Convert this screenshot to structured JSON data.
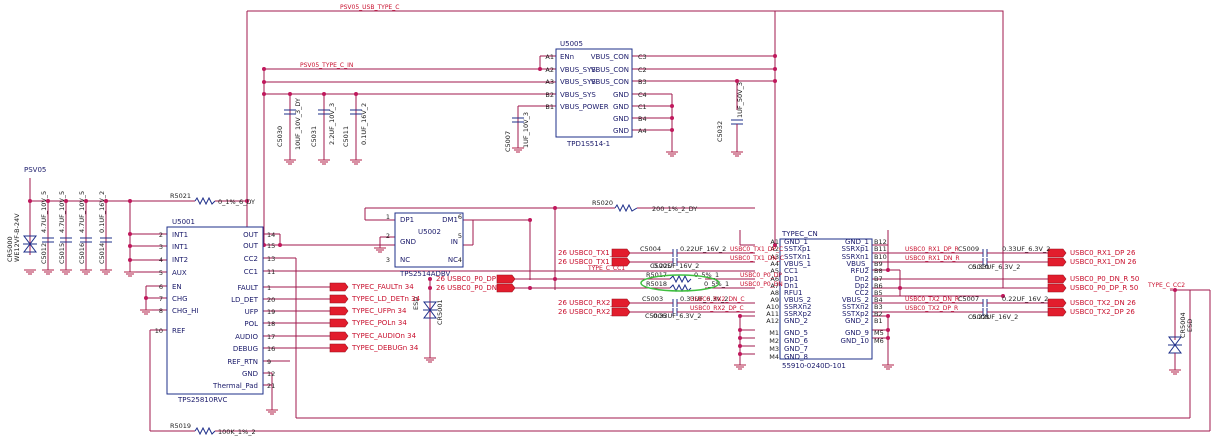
{
  "nets": {
    "psvbus_top": "PSV05_USB_TYPE_C",
    "psvbus_in": "PSV05_TYPE_C_IN",
    "psv05": "PSV05",
    "type_c_cc1": "TYPE_C_CC1",
    "type_c_cc2": "TYPE_C_CC2"
  },
  "u5005": {
    "ref": "U5005",
    "part": "TPD1S514-1",
    "left_pins": [
      {
        "num": "A1",
        "name": "ENn"
      },
      {
        "num": "A2",
        "name": "VBUS_SYS"
      },
      {
        "num": "A3",
        "name": "VBUS_SYS"
      },
      {
        "num": "B2",
        "name": "VBUS_SYS"
      },
      {
        "num": "B1",
        "name": "VBUS_POWER"
      }
    ],
    "right_pins": [
      {
        "num": "C3",
        "name": "VBUS_CON"
      },
      {
        "num": "C2",
        "name": "VBUS_CON"
      },
      {
        "num": "B3",
        "name": "VBUS_CON"
      },
      {
        "num": "C4",
        "name": "GND"
      },
      {
        "num": "C1",
        "name": "GND"
      },
      {
        "num": "B4",
        "name": "GND"
      },
      {
        "num": "A4",
        "name": "GND"
      }
    ]
  },
  "u5001": {
    "ref": "U5001",
    "part": "TPS25810RVC",
    "left_pins": [
      {
        "num": "2",
        "name": "INT1"
      },
      {
        "num": "3",
        "name": "INT1"
      },
      {
        "num": "4",
        "name": "INT2"
      },
      {
        "num": "5",
        "name": "AUX"
      },
      {
        "num": "6",
        "name": "EN"
      },
      {
        "num": "7",
        "name": "CHG"
      },
      {
        "num": "8",
        "name": "CHG_HI"
      },
      {
        "num": "10",
        "name": "REF"
      }
    ],
    "right_pins": [
      {
        "num": "14",
        "name": "OUT"
      },
      {
        "num": "15",
        "name": "OUT"
      },
      {
        "num": "13",
        "name": "CC2"
      },
      {
        "num": "11",
        "name": "CC1"
      },
      {
        "num": "1",
        "name": "FAULT"
      },
      {
        "num": "20",
        "name": "LD_DET"
      },
      {
        "num": "19",
        "name": "UFP"
      },
      {
        "num": "18",
        "name": "POL"
      },
      {
        "num": "17",
        "name": "AUDIO"
      },
      {
        "num": "16",
        "name": "DEBUG"
      },
      {
        "num": "9",
        "name": "REF_RTN"
      },
      {
        "num": "12",
        "name": "GND"
      },
      {
        "num": "21",
        "name": "Thermal_Pad"
      }
    ]
  },
  "u5002": {
    "ref": "U5002",
    "part": "TPS2514ADBV",
    "pins": [
      {
        "num": "1",
        "name": "DP1"
      },
      {
        "num": "6",
        "name": "DM1"
      },
      {
        "num": "2",
        "name": "GND"
      },
      {
        "num": "5",
        "name": "IN"
      },
      {
        "num": "3",
        "name": "NC"
      },
      {
        "num": "4",
        "name": "NC"
      }
    ]
  },
  "connector": {
    "ref": "TYPEC_CN",
    "part": "55910-0240D-101",
    "left_pins": [
      {
        "num": "A1",
        "name": "GND_1"
      },
      {
        "num": "A2",
        "name": "SSTXp1"
      },
      {
        "num": "A3",
        "name": "SSTXn1"
      },
      {
        "num": "A4",
        "name": "VBUS_1"
      },
      {
        "num": "A5",
        "name": "CC1"
      },
      {
        "num": "A6",
        "name": "Dp1"
      },
      {
        "num": "A7",
        "name": "Dn1"
      },
      {
        "num": "A8",
        "name": "RFU1"
      },
      {
        "num": "A9",
        "name": "VBUS_2"
      },
      {
        "num": "A10",
        "name": "SSRXn2"
      },
      {
        "num": "A11",
        "name": "SSRXp2"
      },
      {
        "num": "A12",
        "name": "GND_2"
      },
      {
        "num": "M1",
        "name": "GND_5"
      },
      {
        "num": "M2",
        "name": "GND_6"
      },
      {
        "num": "M3",
        "name": "GND_7"
      },
      {
        "num": "M4",
        "name": "GND_8"
      }
    ],
    "right_pins": [
      {
        "num": "B12",
        "name": "GND_1"
      },
      {
        "num": "B11",
        "name": "SSRXp1"
      },
      {
        "num": "B10",
        "name": "SSRXn1"
      },
      {
        "num": "B9",
        "name": "VBUS_"
      },
      {
        "num": "B8",
        "name": "RFU2"
      },
      {
        "num": "B7",
        "name": "Dn2"
      },
      {
        "num": "B6",
        "name": "Dp2"
      },
      {
        "num": "B5",
        "name": "CC2"
      },
      {
        "num": "B4",
        "name": "VBUS_2"
      },
      {
        "num": "B3",
        "name": "SSTXn2"
      },
      {
        "num": "B2",
        "name": "SSTXp2"
      },
      {
        "num": "B1",
        "name": "GND_2"
      },
      {
        "num": "M5",
        "name": "GND_9"
      },
      {
        "num": "M6",
        "name": "GND_10"
      }
    ]
  },
  "caps_top": [
    {
      "ref": "C5030",
      "val": "10UF_10V_3_DY"
    },
    {
      "ref": "C5031",
      "val": "2.2UF_10V_3"
    },
    {
      "ref": "C5011",
      "val": "0.1UF_16V_2"
    },
    {
      "ref": "C5007",
      "val": "1UF_10V_3"
    },
    {
      "ref": "C5032",
      "val": "1UF_50V_3"
    }
  ],
  "caps_left": [
    {
      "ref": "C5012",
      "val": "4.7UF_10V_5"
    },
    {
      "ref": "C5015",
      "val": "4.7UF_10V_5"
    },
    {
      "ref": "C5016",
      "val": "4.7UF_10V_5"
    },
    {
      "ref": "C5014",
      "val": "0.1UF_16V_2"
    }
  ],
  "esd_left": {
    "ref": "CR5000",
    "val": "WE12VF-B-24V"
  },
  "esd_mid": {
    "ref": "CR5001",
    "val": "ESD"
  },
  "esd_right": {
    "ref": "CR5004",
    "val": "ESD"
  },
  "resistors": {
    "r5021": {
      "ref": "R5021",
      "val": "0_1%_6_DY"
    },
    "r5019": {
      "ref": "R5019",
      "val": "100K_1%_2"
    },
    "r5020": {
      "ref": "R5020",
      "val": "200_1%_2_DY"
    },
    "r5017": {
      "ref": "R5017",
      "val": "0_5%_1"
    },
    "r5018": {
      "ref": "R5018",
      "val": "0_5%_1"
    }
  },
  "status_tags": [
    {
      "num": "1",
      "name": "TYPEC_FAULTn",
      "page": "34"
    },
    {
      "num": "20",
      "name": "TYPEC_LD_DETn",
      "page": "34"
    },
    {
      "num": "19",
      "name": "TYPEC_UFPn",
      "page": "34"
    },
    {
      "num": "18",
      "name": "TYPEC_POLn",
      "page": "34"
    },
    {
      "num": "17",
      "name": "TYPEC_AUDIOn",
      "page": "34"
    },
    {
      "num": "16",
      "name": "TYPEC_DEBUGn",
      "page": "34"
    }
  ],
  "usb2_tags": [
    {
      "page": "26",
      "name": "USBC0_P0_DP"
    },
    {
      "page": "26",
      "name": "USBC0_P0_DN"
    }
  ],
  "left_ss_tags": [
    {
      "page": "26",
      "name": "USBC0_TX1_DP",
      "cap": "C5004",
      "cap_val": "0.22UF_16V_2"
    },
    {
      "page": "26",
      "name": "USBC0_TX1_DN",
      "cap": "C5005",
      "cap_val": "0.22UF_16V_2"
    },
    {
      "page": "26",
      "name": "USBC0_RX2_DN",
      "cap": "C5003",
      "cap_val": "0.33UF_6.3V_2"
    },
    {
      "page": "26",
      "name": "USBC0_RX2_DP",
      "cap": "C5006",
      "cap_val": "0.33UF_6.3V_2"
    }
  ],
  "right_ss_tags": [
    {
      "name": "USBC0_RX1_DP",
      "page": "26",
      "cap": "C5009",
      "cap_val": "0.33UF_6.3V_2"
    },
    {
      "name": "USBC0_RX1_DN",
      "page": "26",
      "cap": "C5010",
      "cap_val": "0.33UF_6.3V_2"
    },
    {
      "name": "USBC0_P0_DN_R",
      "page": "50"
    },
    {
      "name": "USBC0_P0_DP_R",
      "page": "50"
    },
    {
      "name": "USBC0_TX2_DN",
      "page": "26",
      "cap": "C5007",
      "cap_val": "0.22UF_16V_2"
    },
    {
      "name": "USBC0_TX2_DP",
      "page": "26",
      "cap": "C5008",
      "cap_val": "0.22UF_16V_2"
    }
  ],
  "trace_labels": [
    "USBC0_TX1_DP_C",
    "USBC0_TX1_DN_C",
    "USBC0_P0_DP",
    "USBC0_P0_DN",
    "USBC0_RX2_DN_C",
    "USBC0_RX2_DP_C",
    "USBC0_RX1_DP_R",
    "USBC0_RX1_DN_R",
    "USBC0_TX2_DN_R",
    "USBC0_TX2_DP_R"
  ]
}
